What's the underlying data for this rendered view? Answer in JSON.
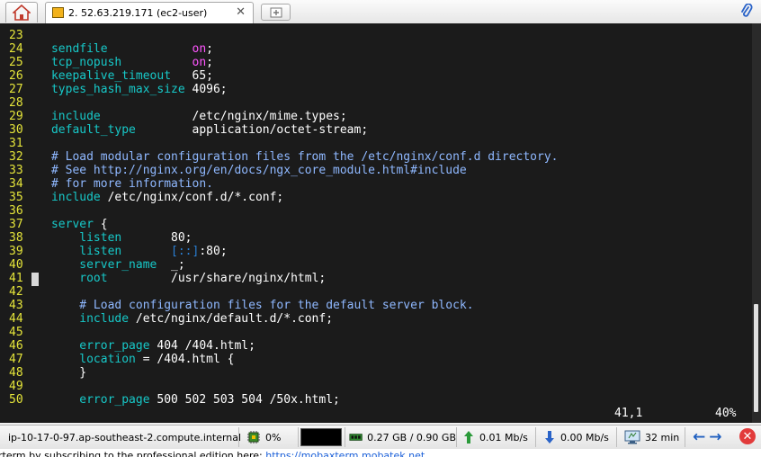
{
  "tabs": {
    "home_icon": "home-icon",
    "active": {
      "icon": "key-icon",
      "title": "2. 52.63.219.171 (ec2-user)",
      "close": "✕"
    },
    "new_tab_icon": "plus-icon",
    "attach_icon": "paperclip-icon"
  },
  "terminal": {
    "lines": [
      {
        "n": "23",
        "seg": []
      },
      {
        "n": "24",
        "seg": [
          [
            "    sendfile            ",
            "d"
          ],
          [
            "on",
            "k"
          ],
          [
            ";",
            "v"
          ]
        ]
      },
      {
        "n": "25",
        "seg": [
          [
            "    tcp_nopush          ",
            "d"
          ],
          [
            "on",
            "k"
          ],
          [
            ";",
            "v"
          ]
        ]
      },
      {
        "n": "26",
        "seg": [
          [
            "    keepalive_timeout   ",
            "d"
          ],
          [
            "65;",
            "v"
          ]
        ]
      },
      {
        "n": "27",
        "seg": [
          [
            "    types_hash_max_size ",
            "d"
          ],
          [
            "4096;",
            "v"
          ]
        ]
      },
      {
        "n": "28",
        "seg": []
      },
      {
        "n": "29",
        "seg": [
          [
            "    include             ",
            "dir"
          ],
          [
            "/etc/nginx/mime.types;",
            "v"
          ]
        ]
      },
      {
        "n": "30",
        "seg": [
          [
            "    default_type        ",
            "d"
          ],
          [
            "application/octet-stream;",
            "v"
          ]
        ]
      },
      {
        "n": "31",
        "seg": []
      },
      {
        "n": "32",
        "seg": [
          [
            "    # Load modular configuration files from the /etc/nginx/conf.d directory.",
            "c"
          ]
        ]
      },
      {
        "n": "33",
        "seg": [
          [
            "    # See http://nginx.org/en/docs/ngx_core_module.html#include",
            "c"
          ]
        ]
      },
      {
        "n": "34",
        "seg": [
          [
            "    # for more information.",
            "c"
          ]
        ]
      },
      {
        "n": "35",
        "seg": [
          [
            "    include ",
            "dir"
          ],
          [
            "/etc/nginx/conf.d/*.conf;",
            "v"
          ]
        ]
      },
      {
        "n": "36",
        "seg": []
      },
      {
        "n": "37",
        "seg": [
          [
            "    server ",
            "d"
          ],
          [
            "{",
            "v"
          ]
        ]
      },
      {
        "n": "38",
        "seg": [
          [
            "        listen       ",
            "d"
          ],
          [
            "80;",
            "v"
          ]
        ]
      },
      {
        "n": "39",
        "seg": [
          [
            "        listen       ",
            "d"
          ],
          [
            "[::]",
            "ip"
          ],
          [
            ":80;",
            "v"
          ]
        ]
      },
      {
        "n": "40",
        "seg": [
          [
            "        server_name  ",
            "d"
          ],
          [
            "_;",
            "v"
          ]
        ]
      },
      {
        "n": "41",
        "seg": [
          [
            "        root         ",
            "d"
          ],
          [
            "/usr/share/nginx/html;",
            "v"
          ]
        ]
      },
      {
        "n": "42",
        "seg": []
      },
      {
        "n": "43",
        "seg": [
          [
            "        # Load configuration files for the default server block.",
            "c"
          ]
        ]
      },
      {
        "n": "44",
        "seg": [
          [
            "        include ",
            "dir"
          ],
          [
            "/etc/nginx/default.d/*.conf;",
            "v"
          ]
        ]
      },
      {
        "n": "45",
        "seg": []
      },
      {
        "n": "46",
        "seg": [
          [
            "        error_page ",
            "d"
          ],
          [
            "404 /404.html;",
            "v"
          ]
        ]
      },
      {
        "n": "47",
        "seg": [
          [
            "        location ",
            "d"
          ],
          [
            "= /404.html {",
            "v"
          ]
        ]
      },
      {
        "n": "48",
        "seg": [
          [
            "        }",
            "v"
          ]
        ]
      },
      {
        "n": "49",
        "seg": []
      },
      {
        "n": "50",
        "seg": [
          [
            "        error_page ",
            "d"
          ],
          [
            "500 502 503 504 /50x.html;",
            "v"
          ]
        ]
      }
    ],
    "status_position": "41,1",
    "status_percent": "40%"
  },
  "colors": {
    "terminal_bg": "#1b1b1b",
    "line_number": "#e5e53a",
    "directive": "#17c8c8",
    "keyword": "#ff55ff",
    "comment": "#8fb8ff"
  },
  "statusbar": {
    "host": "ip-10-17-0-97.ap-southeast-2.compute.internal",
    "cpu": "0%",
    "memory": "0.27 GB / 0.90 GB",
    "upload": "0.01 Mb/s",
    "download": "0.00 Mb/s",
    "uptime": "32 min"
  },
  "footer": {
    "text": "rterm by subscribing to the professional edition here: ",
    "link": "https://mobaxterm.mobatek.net"
  }
}
